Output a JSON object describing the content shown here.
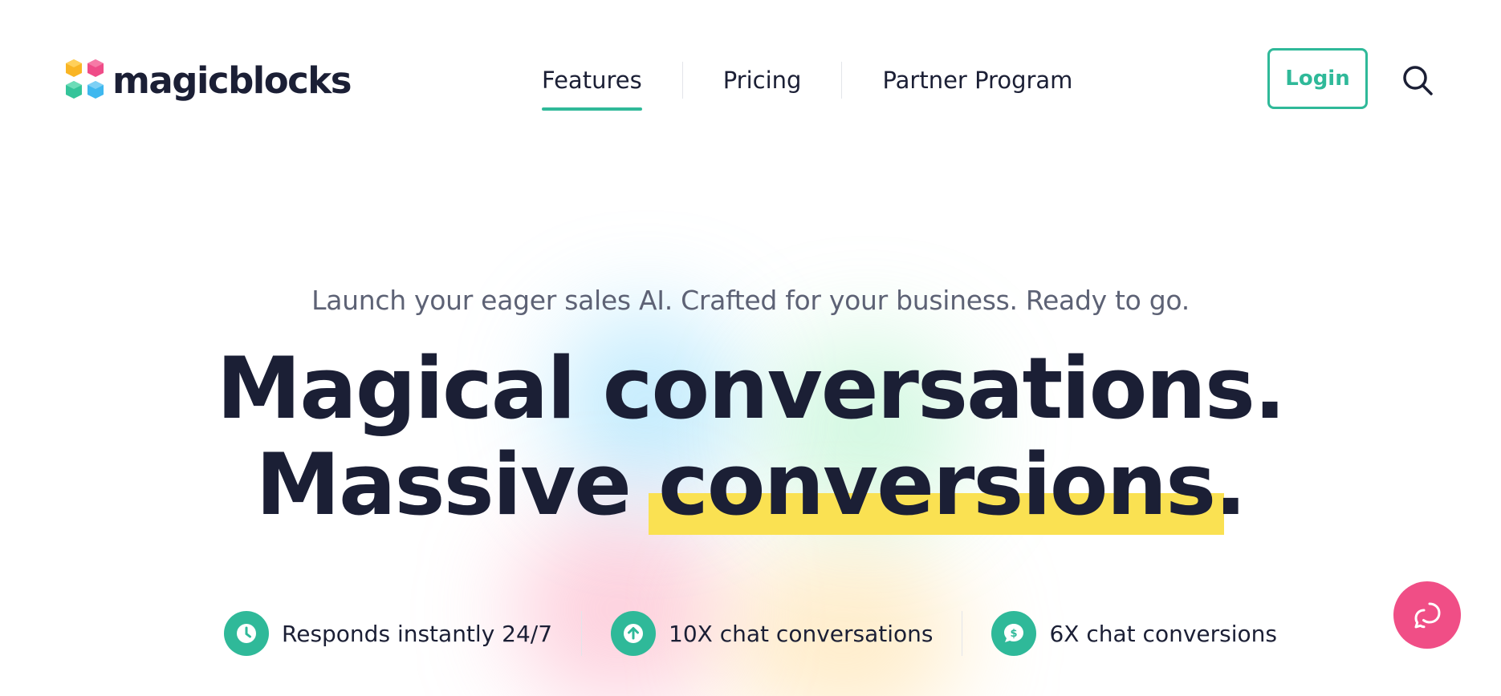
{
  "brand": {
    "name": "magicblocks",
    "logo_colors": [
      "#f9b524",
      "#ef4c88",
      "#35c49a",
      "#3fb8ef"
    ]
  },
  "nav": {
    "items": [
      {
        "label": "Features",
        "active": true
      },
      {
        "label": "Pricing",
        "active": false
      },
      {
        "label": "Partner Program",
        "active": false
      }
    ],
    "login_label": "Login",
    "search_icon": "search-icon"
  },
  "hero": {
    "subtitle": "Launch your eager sales AI. Crafted for your business. Ready to go.",
    "headline_line1": "Magical conversations.",
    "headline_line2_pre": "Massive ",
    "headline_line2_highlight": "conversions",
    "headline_line2_post": "."
  },
  "features": [
    {
      "icon": "clock-icon",
      "label": "Responds instantly 24/7"
    },
    {
      "icon": "arrow-up-icon",
      "label": "10X chat conversations"
    },
    {
      "icon": "dollar-chat-icon",
      "label": "6X chat conversions"
    }
  ],
  "chat": {
    "icon": "chat-bubble-icon"
  },
  "colors": {
    "accent": "#2fb999",
    "highlight": "#fae152",
    "text": "#1b1f35",
    "muted": "#5d6275",
    "chat": "#f04e86"
  }
}
